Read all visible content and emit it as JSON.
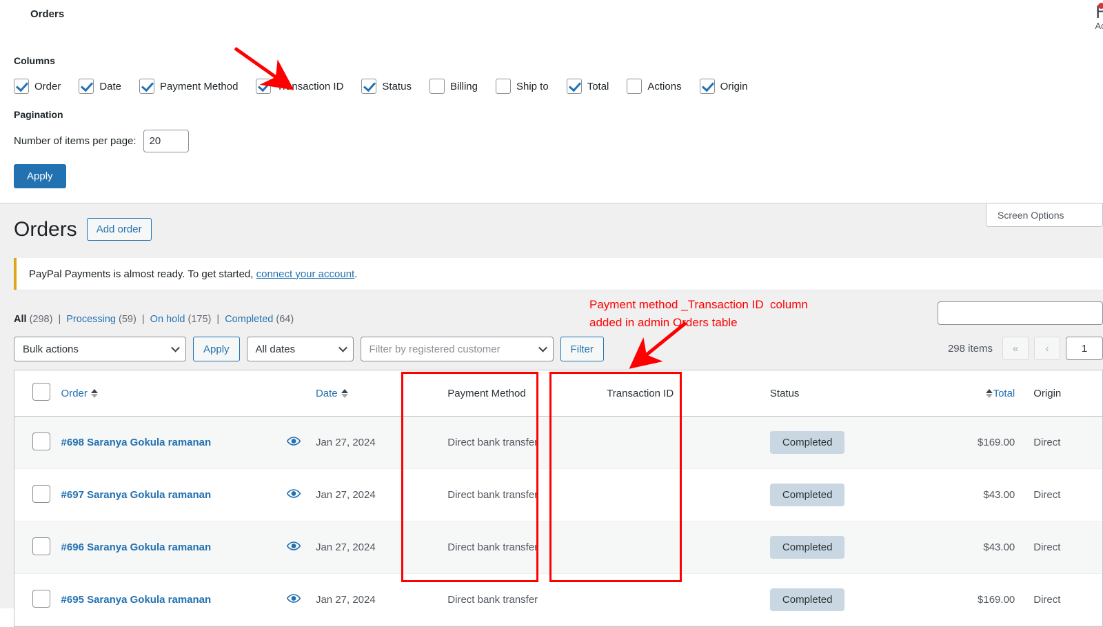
{
  "screen_options": {
    "title": "Orders",
    "columns_label": "Columns",
    "pagination_label": "Pagination",
    "per_page_label": "Number of items per page:",
    "per_page_value": "20",
    "apply_label": "Apply",
    "tab_label": "Screen Options",
    "help_partial": "H",
    "actions_partial": "Acti",
    "columns": [
      {
        "label": "Order",
        "checked": true
      },
      {
        "label": "Date",
        "checked": true
      },
      {
        "label": "Payment Method",
        "checked": true
      },
      {
        "label": "Transaction ID",
        "checked": true
      },
      {
        "label": "Status",
        "checked": true
      },
      {
        "label": "Billing",
        "checked": false
      },
      {
        "label": "Ship to",
        "checked": false
      },
      {
        "label": "Total",
        "checked": true
      },
      {
        "label": "Actions",
        "checked": false
      },
      {
        "label": "Origin",
        "checked": true
      }
    ]
  },
  "page": {
    "title": "Orders",
    "add_order_label": "Add order"
  },
  "notice": {
    "text_before": "PayPal Payments is almost ready. To get started, ",
    "link_text": "connect your account",
    "text_after": "."
  },
  "status_links": [
    {
      "label": "All",
      "count": "(298)",
      "current": true
    },
    {
      "label": "Processing",
      "count": "(59)",
      "current": false
    },
    {
      "label": "On hold",
      "count": "(175)",
      "current": false
    },
    {
      "label": "Completed",
      "count": "(64)",
      "current": false
    }
  ],
  "toolbar": {
    "bulk_actions_value": "Bulk actions",
    "apply_label": "Apply",
    "all_dates_value": "All dates",
    "customer_placeholder": "Filter by registered customer",
    "filter_label": "Filter",
    "search_value": ""
  },
  "pagination": {
    "items_label": "298 items",
    "first_label": "«",
    "prev_label": "‹",
    "current_page": "1"
  },
  "table": {
    "headers": {
      "order": "Order",
      "date": "Date",
      "payment_method": "Payment Method",
      "transaction_id": "Transaction ID",
      "status": "Status",
      "total": "Total",
      "origin": "Origin"
    },
    "rows": [
      {
        "order": "#698 Saranya Gokula ramanan",
        "date": "Jan 27, 2024",
        "payment_method": "Direct bank transfer",
        "transaction_id": "",
        "status": "Completed",
        "total": "$169.00",
        "origin": "Direct"
      },
      {
        "order": "#697 Saranya Gokula ramanan",
        "date": "Jan 27, 2024",
        "payment_method": "Direct bank transfer",
        "transaction_id": "",
        "status": "Completed",
        "total": "$43.00",
        "origin": "Direct"
      },
      {
        "order": "#696 Saranya Gokula ramanan",
        "date": "Jan 27, 2024",
        "payment_method": "Direct bank transfer",
        "transaction_id": "",
        "status": "Completed",
        "total": "$43.00",
        "origin": "Direct"
      },
      {
        "order": "#695 Saranya Gokula ramanan",
        "date": "Jan 27, 2024",
        "payment_method": "Direct bank transfer",
        "transaction_id": "",
        "status": "Completed",
        "total": "$169.00",
        "origin": "Direct"
      }
    ]
  },
  "annotations": {
    "line1": "Payment method _Transaction ID  column",
    "line2": "added in admin Orders table",
    "color": "#ff0000"
  },
  "colors": {
    "accent_blue": "#2271b1",
    "annotation_red": "#ff0000",
    "status_pill_bg": "#c8d7e1",
    "notice_border": "#dba617",
    "admin_bg": "#f0f0f1"
  }
}
